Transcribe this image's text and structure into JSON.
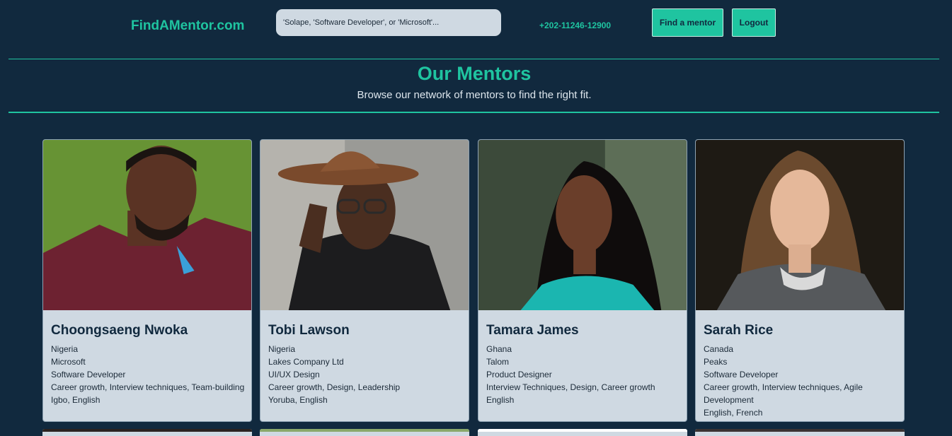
{
  "header": {
    "logo": "FindAMentor.com",
    "search_placeholder": "'Solape, 'Software Developer', or 'Microsoft'...",
    "phone": "+202-11246-12900",
    "find_mentor_label": "Find a mentor",
    "logout_label": "Logout"
  },
  "hero": {
    "title": "Our Mentors",
    "subtitle": "Browse our network of mentors to find the right fit."
  },
  "mentors": [
    {
      "name": "Choongsaeng Nwoka",
      "country": "Nigeria",
      "company": "Microsoft",
      "role": "Software Developer",
      "skills": "Career growth, Interview techniques, Team-building",
      "languages": "Igbo, English"
    },
    {
      "name": "Tobi Lawson",
      "country": "Nigeria",
      "company": "Lakes Company Ltd",
      "role": "UI/UX Design",
      "skills": "Career growth, Design, Leadership",
      "languages": "Yoruba, English"
    },
    {
      "name": "Tamara James",
      "country": "Ghana",
      "company": "Talom",
      "role": "Product Designer",
      "skills": "Interview Techniques, Design, Career growth",
      "languages": "English"
    },
    {
      "name": "Sarah Rice",
      "country": "Canada",
      "company": "Peaks",
      "role": "Software Developer",
      "skills": "Career growth, Interview techniques, Agile Development",
      "languages": "English, French"
    }
  ],
  "colors": {
    "accent": "#1fc4a0",
    "background": "#11293e",
    "card": "#cfd9e2"
  }
}
